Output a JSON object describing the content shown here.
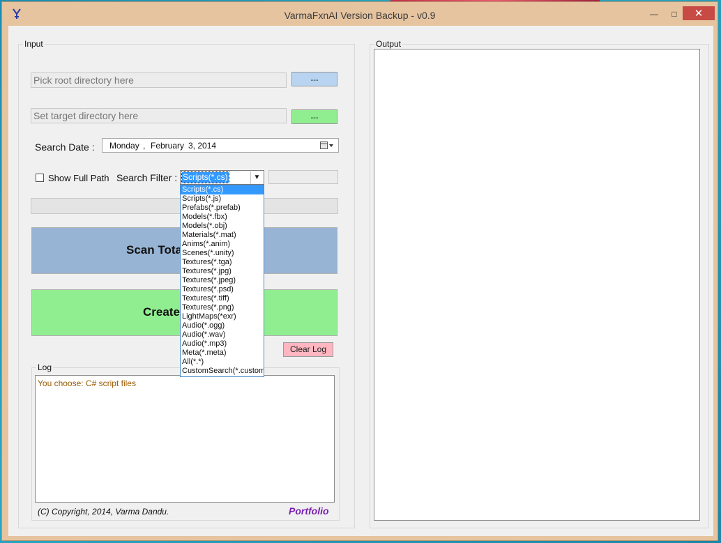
{
  "window": {
    "title": "VarmaFxnAI Version Backup - v0.9",
    "controls": {
      "minimize": "—",
      "maximize": "□",
      "close": "✕"
    }
  },
  "input_group": {
    "legend": "Input",
    "root_dir_placeholder": "Pick root directory here",
    "root_browse_label": "---",
    "target_dir_placeholder": "Set target directory here",
    "target_browse_label": "---",
    "search_date_label": "Search Date :",
    "date": {
      "day": "Monday",
      "sep": ",",
      "month": "February",
      "rest": "3, 2014"
    },
    "show_full_path_label": "Show Full Path",
    "show_full_path_checked": false,
    "search_filter_label": "Search Filter :",
    "search_filter_value": "Scripts(*.cs)",
    "search_filter_options": [
      "Scripts(*.cs)",
      "Scripts(*.js)",
      "Prefabs(*.prefab)",
      "Models(*.fbx)",
      "Models(*.obj)",
      "Materials(*.mat)",
      "Anims(*.anim)",
      "Scenes(*.unity)",
      "Textures(*.tga)",
      "Textures(*.jpg)",
      "Textures(*.jpeg)",
      "Textures(*.psd)",
      "Textures(*.tiff)",
      "Textures(*.png)",
      "LightMaps(*exr)",
      "Audio(*.ogg)",
      "Audio(*.wav)",
      "Audio(*.mp3)",
      "Meta(*.meta)",
      "All(*.*)",
      "CustomSearch(*.customE"
    ],
    "selected_option_index": 0,
    "scan_button_label": "Scan Tota",
    "create_button_label": "Create",
    "clear_log_label": "Clear Log"
  },
  "log_group": {
    "legend": "Log",
    "text": "You choose:  C# script files"
  },
  "footer": {
    "copyright": "(C) Copyright, 2014, Varma Dandu.",
    "portfolio": "Portfolio"
  },
  "output_group": {
    "legend": "Output"
  },
  "colors": {
    "title_bar": "#e6c4a0",
    "root_browse_bg": "#b8d4f0",
    "target_browse_bg": "#90ee90",
    "scan_button_bg": "#98b4d4",
    "create_button_bg": "#90ee90",
    "clear_log_bg": "#ffb6c1",
    "selection": "#3399ff",
    "portfolio_text": "#7a1fb0",
    "log_text": "#9a5a00"
  }
}
